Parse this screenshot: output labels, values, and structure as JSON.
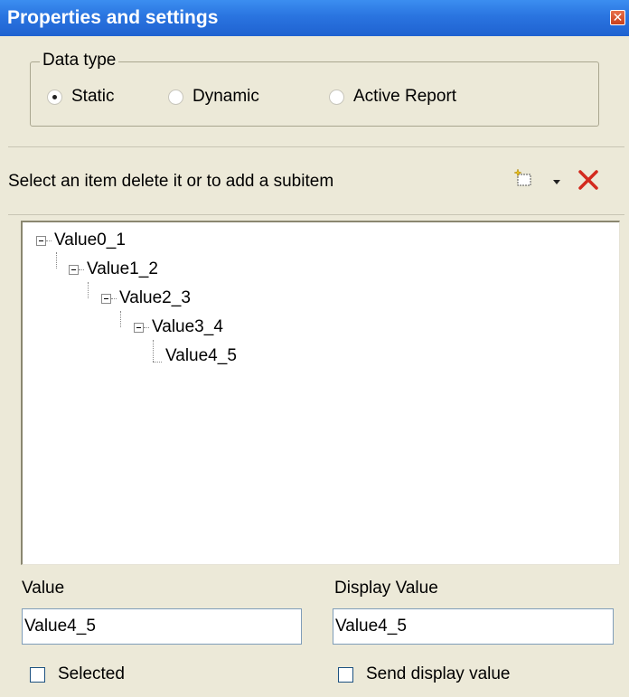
{
  "window": {
    "title": "Properties and settings",
    "close_glyph": "✕"
  },
  "data_type": {
    "legend": "Data type",
    "options": [
      {
        "label": "Static",
        "selected": true
      },
      {
        "label": "Dynamic",
        "selected": false
      },
      {
        "label": "Active Report",
        "selected": false
      }
    ]
  },
  "toolbar": {
    "instruction": "Select an item delete it or to add a subitem",
    "icons": [
      "new-item-icon",
      "dropdown-arrow-icon",
      "delete-icon"
    ],
    "delete_color": "#d32a1e"
  },
  "tree": {
    "nodes": [
      {
        "label": "Value0_1",
        "level": 0,
        "expanded": true
      },
      {
        "label": "Value1_2",
        "level": 1,
        "expanded": true
      },
      {
        "label": "Value2_3",
        "level": 2,
        "expanded": true
      },
      {
        "label": "Value3_4",
        "level": 3,
        "expanded": true
      },
      {
        "label": "Value4_5",
        "level": 4,
        "leaf": true
      }
    ]
  },
  "fields": {
    "value_label": "Value",
    "value": "Value4_5",
    "display_value_label": "Display Value",
    "display_value": "Value4_5",
    "selected_label": "Selected",
    "selected_checked": false,
    "send_display_label": "Send display value",
    "send_display_checked": false
  },
  "colors": {
    "titlebar": "#2a74e0",
    "dialog_bg": "#ece9d8"
  }
}
